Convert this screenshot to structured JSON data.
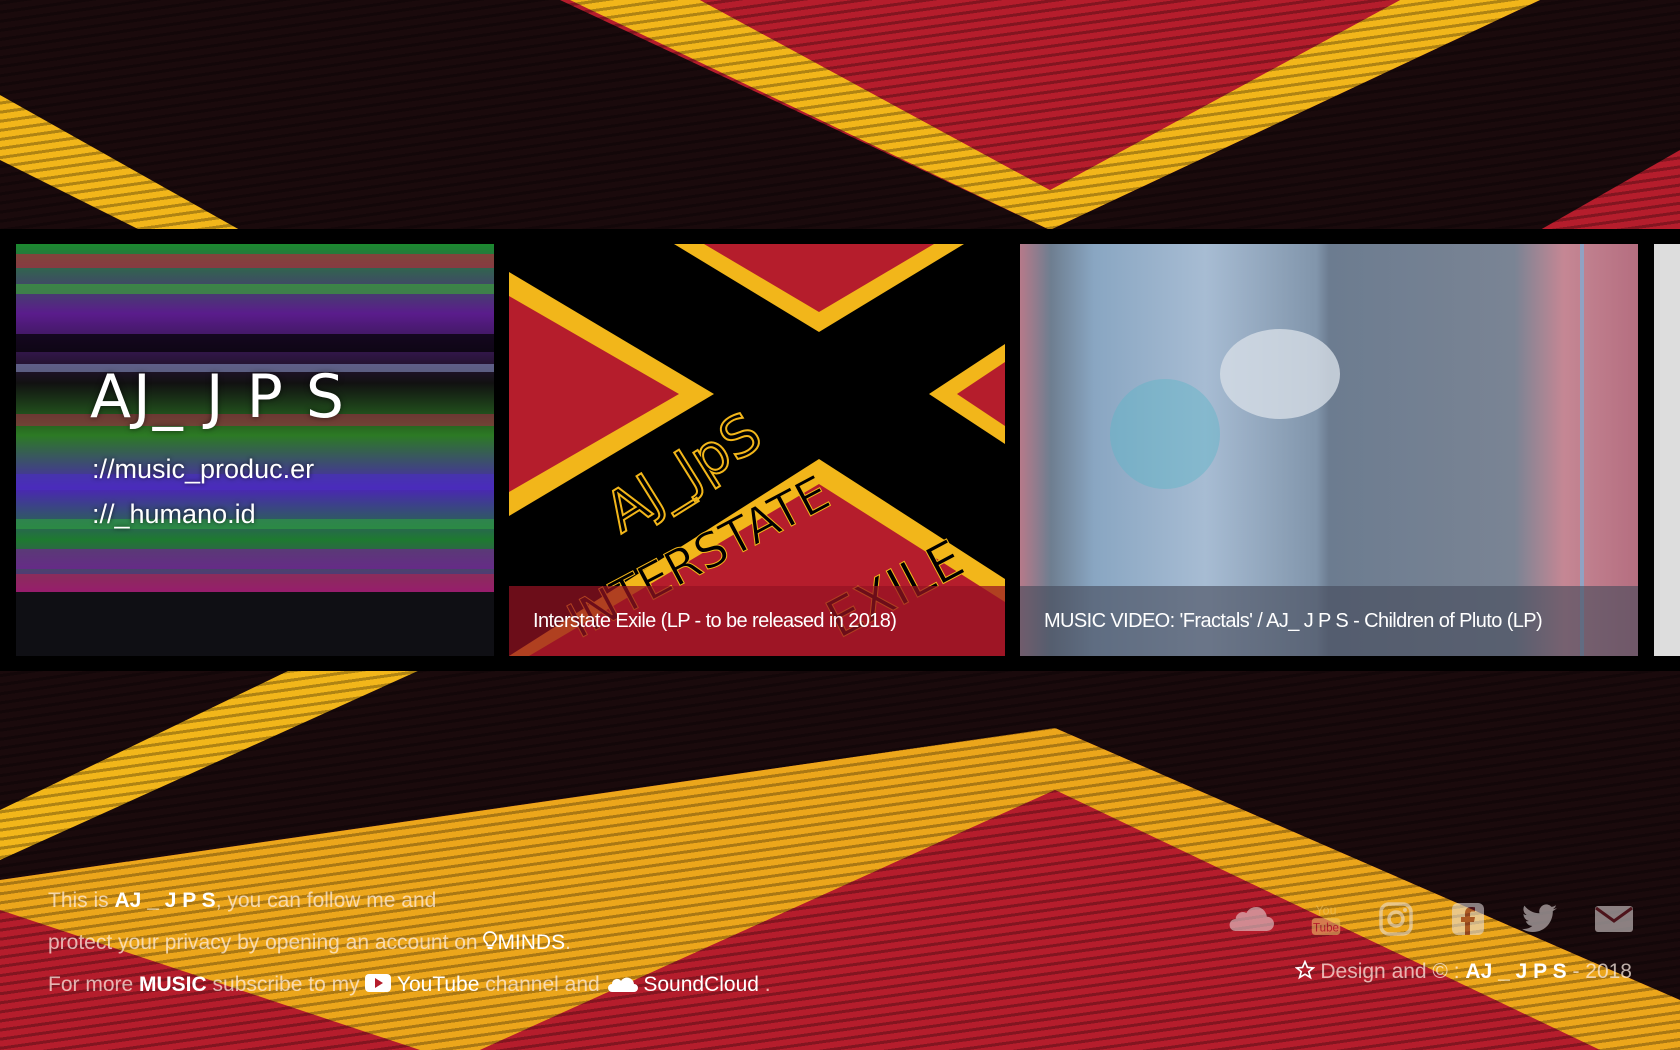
{
  "intro": {
    "title": "AJ_ J P S",
    "line1": "://music_produc.er",
    "line2": "://_humano.id"
  },
  "cards": [
    {
      "caption": "Interstate Exile (LP - to be released in 2018)",
      "art_text_1": "AJ_JpS",
      "art_text_2": "INTERSTATE",
      "art_text_3": "EXILE"
    },
    {
      "caption": "MUSIC VIDEO: 'Fractals' / AJ_ J P S - Children of Pluto (LP)"
    }
  ],
  "footer": {
    "p1_before": "This is ",
    "p1_name": "AJ _ J P S",
    "p1_after": ", you can follow me and",
    "p2_before": "protect your privacy by opening an account on ",
    "p2_link": "MINDS",
    "p2_after": ".",
    "p3_before": "For more ",
    "p3_bold": "MUSIC",
    "p3_mid": " subscribe to my ",
    "p3_youtube": "YouTube",
    "p3_and": " channel and ",
    "p3_soundcloud": "SoundCloud",
    "p3_end": " ."
  },
  "social": [
    "soundcloud-icon",
    "youtube-icon",
    "instagram-icon",
    "facebook-icon",
    "twitter-icon",
    "mail-icon"
  ],
  "youtube_logo": {
    "line1": "You",
    "line2": "Tube"
  },
  "copyright": {
    "prefix": "Design and © : ",
    "name": "AJ _ J P S",
    "suffix": " - 2018"
  },
  "colors": {
    "red": "#b51d2c",
    "yellow": "#f2b61a",
    "black": "#000000"
  }
}
